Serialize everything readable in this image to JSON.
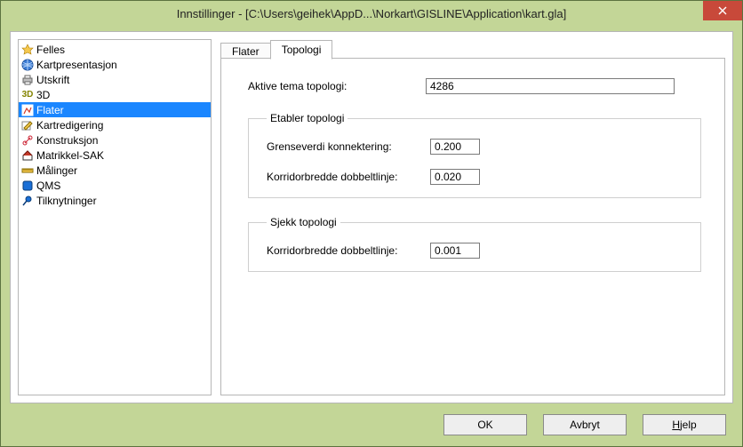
{
  "window": {
    "title": "Innstillinger - [C:\\Users\\geihek\\AppD...\\Norkart\\GISLINE\\Application\\kart.gla]"
  },
  "tree": {
    "items": [
      {
        "label": "Felles",
        "icon": "felles"
      },
      {
        "label": "Kartpresentasjon",
        "icon": "globe"
      },
      {
        "label": "Utskrift",
        "icon": "printer"
      },
      {
        "label": "3D",
        "icon": "3d"
      },
      {
        "label": "Flater",
        "icon": "flater",
        "selected": true
      },
      {
        "label": "Kartredigering",
        "icon": "editmap"
      },
      {
        "label": "Konstruksjon",
        "icon": "construct"
      },
      {
        "label": "Matrikkel-SAK",
        "icon": "house"
      },
      {
        "label": "Målinger",
        "icon": "measure"
      },
      {
        "label": "QMS",
        "icon": "qms"
      },
      {
        "label": "Tilknytninger",
        "icon": "pin"
      }
    ]
  },
  "tabs": {
    "items": [
      {
        "label": "Flater",
        "active": false
      },
      {
        "label": "Topologi",
        "active": true
      }
    ]
  },
  "form": {
    "aktive_tema_label": "Aktive tema topologi:",
    "aktive_tema_value": "4286",
    "etabler_legend": "Etabler topologi",
    "grenseverdi_label": "Grenseverdi konnektering:",
    "grenseverdi_value": "0.200",
    "etabler_korridor_label": "Korridorbredde dobbeltlinje:",
    "etabler_korridor_value": "0.020",
    "sjekk_legend": "Sjekk topologi",
    "sjekk_korridor_label": "Korridorbredde dobbeltlinje:",
    "sjekk_korridor_value": "0.001"
  },
  "buttons": {
    "ok": "OK",
    "cancel": "Avbryt",
    "help_prefix": "H",
    "help_rest": "jelp"
  }
}
